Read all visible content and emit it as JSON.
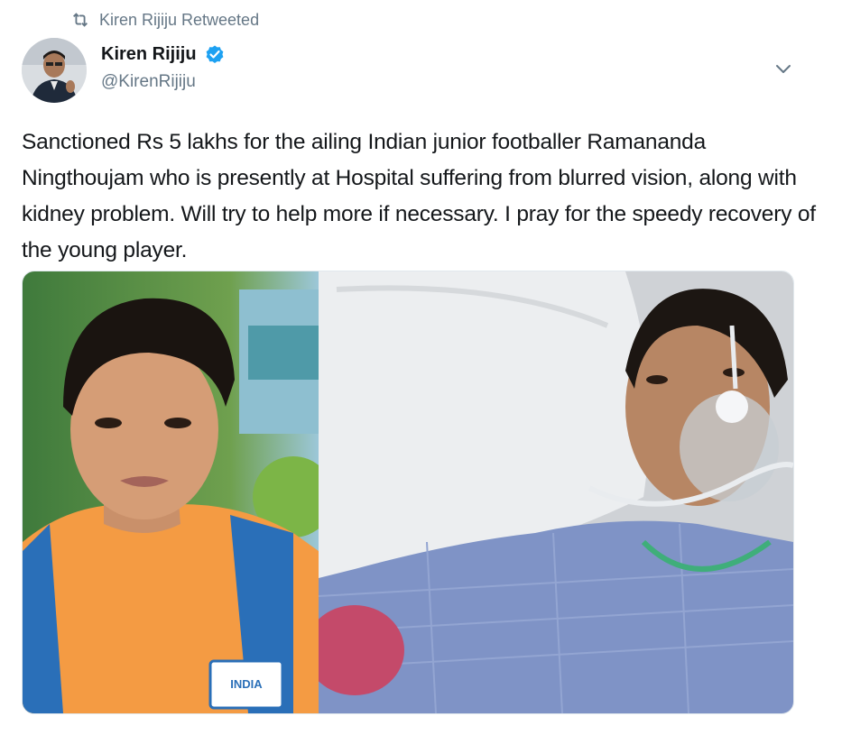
{
  "retweet_banner": {
    "text": "Kiren Rijiju Retweeted",
    "icon": "retweet-icon"
  },
  "author": {
    "name": "Kiren Rijiju",
    "handle": "@KirenRijiju",
    "verified": true,
    "verified_color": "#1da1f2"
  },
  "tweet": {
    "text": "Sanctioned Rs 5 lakhs for the ailing Indian junior footballer Ramananda Ningthoujam who is presently at Hospital suffering from blurred vision, along with kidney problem. Will try to help more if necessary. I pray for the speedy recovery of the young player."
  },
  "media": {
    "left_photo_badge": "INDIA",
    "icons": [
      "menu-chevron-down-icon"
    ]
  },
  "colors": {
    "text": "#14171a",
    "secondary": "#657786",
    "accent": "#1da1f2"
  }
}
